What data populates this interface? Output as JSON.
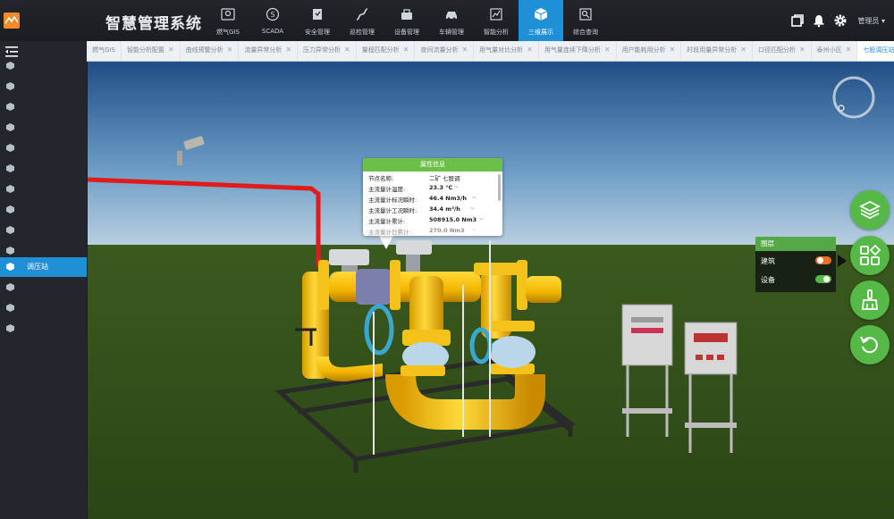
{
  "app": {
    "title": "智慧管理系统",
    "user": "管理员 ▾"
  },
  "nav": [
    {
      "label": "燃气GIS",
      "icon": "map-pin-icon"
    },
    {
      "label": "SCADA",
      "icon": "scada-icon"
    },
    {
      "label": "安全管理",
      "icon": "shield-icon"
    },
    {
      "label": "巡检管理",
      "icon": "route-icon"
    },
    {
      "label": "设备管理",
      "icon": "device-icon"
    },
    {
      "label": "车辆管理",
      "icon": "car-icon"
    },
    {
      "label": "智能分析",
      "icon": "analysis-icon"
    },
    {
      "label": "三维展示",
      "icon": "cube-icon",
      "active": true
    },
    {
      "label": "综合查询",
      "icon": "query-icon"
    }
  ],
  "tabs": [
    {
      "label": "燃气GIS"
    },
    {
      "label": "智能分析配置"
    },
    {
      "label": "曲线预警分析"
    },
    {
      "label": "流量异常分析"
    },
    {
      "label": "压力异常分析"
    },
    {
      "label": "量程匹配分析"
    },
    {
      "label": "夜间流量分析"
    },
    {
      "label": "用气量对比分析"
    },
    {
      "label": "用气量连续下降分析"
    },
    {
      "label": "用户能耗用分析"
    },
    {
      "label": "时段用量异常分析"
    },
    {
      "label": "口径匹配分析"
    },
    {
      "label": "泰州小区"
    },
    {
      "label": "七股调压站",
      "active": true
    }
  ],
  "sidebar": {
    "active_label": "调压站"
  },
  "popup": {
    "title": "属性信息",
    "rows": [
      {
        "key": "节点名称:",
        "value": "二矿 七股调",
        "trend": ""
      },
      {
        "key": "主流量计温度:",
        "value": "23.3 °C",
        "trend": "~"
      },
      {
        "key": "主流量计标况瞬时:",
        "value": "46.4 Nm3/h",
        "trend": "~"
      },
      {
        "key": "主流量计工况瞬时:",
        "value": "34.4 m³/h",
        "trend": "~"
      },
      {
        "key": "主流量计累计:",
        "value": "508915.0 Nm3",
        "trend": "~"
      },
      {
        "key": "主流量计日累计:",
        "value": "270.0 Nm3",
        "trend": "~"
      }
    ]
  },
  "layers": {
    "title": "图层",
    "items": [
      {
        "label": "建筑",
        "on": false
      },
      {
        "label": "设备",
        "on": true
      }
    ]
  },
  "colors": {
    "accent": "#1f8fd6",
    "green": "#56b947",
    "pipe": "#f7c21a",
    "redline": "#e01b1b"
  }
}
